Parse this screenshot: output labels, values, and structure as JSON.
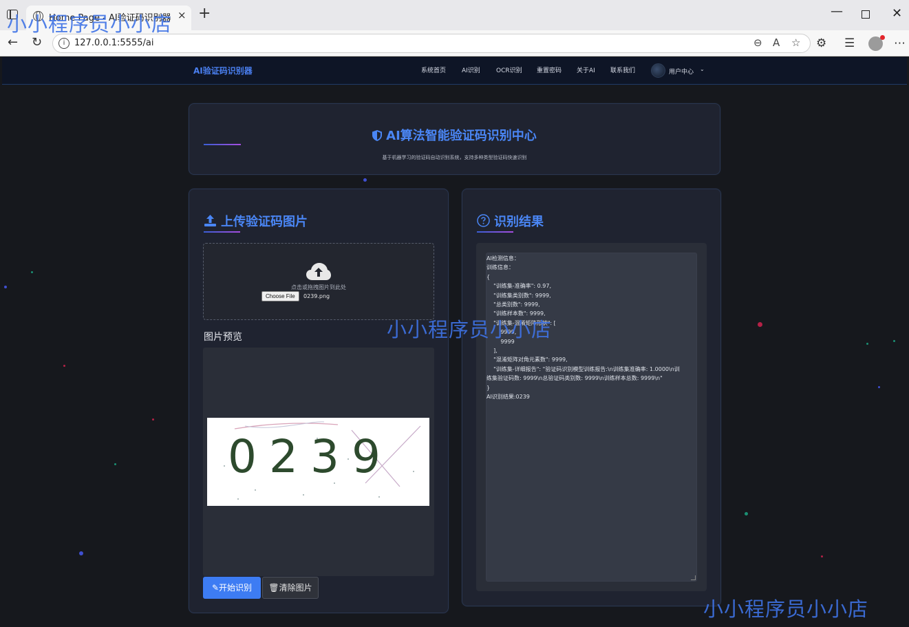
{
  "browser": {
    "tab_title": "Home Page - AI验证码识别器",
    "tab_close": "×",
    "new_tab": "+",
    "url": "127.0.0.1:5555/ai",
    "win_min": "—",
    "win_close": "✕"
  },
  "navbar": {
    "brand": "AI验证码识别器",
    "items": [
      "系统首页",
      "AI识别",
      "OCR识别",
      "重置密码",
      "关于AI",
      "联系我们"
    ],
    "user_menu": "用户中心",
    "caret": "⌄"
  },
  "hero": {
    "title": "AI算法智能验证码识别中心",
    "subtitle": "基于机器学习的验证码自动识别系统，支持多种类型验证码快速识别"
  },
  "upload": {
    "title": "上传验证码图片",
    "hint": "点击或拖拽图片到此处",
    "choose_file": "Choose File",
    "file_name": "0239.png",
    "preview_label": "图片预览",
    "captcha_text": "0239",
    "start_button": "开始识别",
    "clear_button": "清除图片"
  },
  "result": {
    "title": "识别结果",
    "lines": [
      "AI检测信息：",
      "训练信息：",
      "{",
      "    \"训练集-准确率\": 0.97,",
      "    \"训练集类别数\": 9999,",
      "    \"总类别数\": 9999,",
      "    \"训练样本数\": 9999,",
      "    \"训练集-混淆矩阵形状\": [",
      "        9999,",
      "        9999",
      "    ],",
      "    \"混淆矩阵对角元素数\": 9999,",
      "    \"训练集-详细报告\": \"验证码识别模型训练报告:\\n训练集准确率: 1.0000\\n训",
      "练集验证码数: 9999\\n总验证码类别数: 9999\\n训练样本总数: 9999\\n\"",
      "}",
      "AI识别结果:0239"
    ]
  },
  "watermark": "小小程序员小小店",
  "colors": {
    "accent": "#4a86f5",
    "primary_button": "#3d7cf3",
    "watermark": "#3f73e6"
  }
}
